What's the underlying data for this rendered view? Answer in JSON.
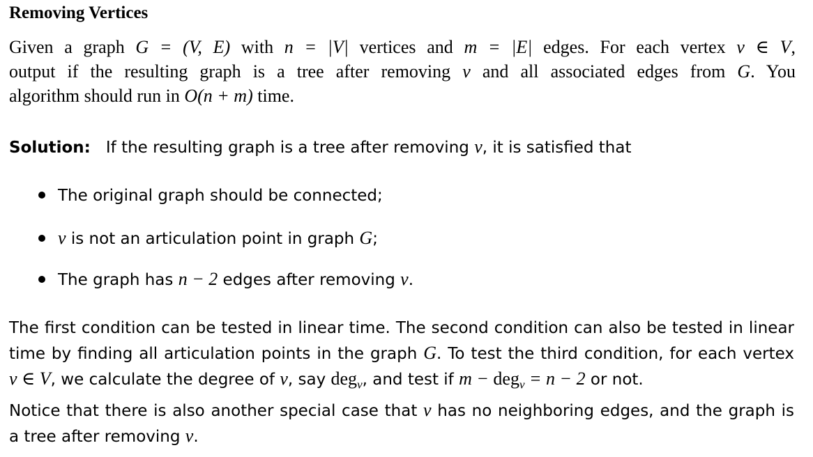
{
  "title": "Removing Vertices",
  "problem": {
    "line1_a": "Given a graph ",
    "line1_b": " with ",
    "line1_c": " vertices and ",
    "line1_d": " edges. For each vertex ",
    "line1_e": ",",
    "line2_a": "output if the resulting graph is a tree after removing ",
    "line2_b": " and all associated edges from ",
    "line2_c": ". You",
    "line3_a": "algorithm should run in ",
    "line3_b": " time.",
    "math": {
      "G_VE": "G = (V, E)",
      "n_V": "n = |V|",
      "m_E": "m = |E|",
      "v_in_V": "v ∈ V",
      "v": "v",
      "G": "G",
      "O_nm": "O(n + m)"
    }
  },
  "solution": {
    "label": "Solution:",
    "intro_a": "If the resulting graph is a tree after removing ",
    "intro_v": "v",
    "intro_b": ", it is satisfied that",
    "bullets": {
      "b1": "The original graph should be connected;",
      "b2_v": "v",
      "b2_text": " is not an articulation point in graph ",
      "b2_G": "G",
      "b2_end": ";",
      "b3_a": "The graph has ",
      "b3_math": "n − 2",
      "b3_b": " edges after removing ",
      "b3_v": "v",
      "b3_end": "."
    },
    "para1": {
      "line1": "The first condition can be tested in linear time. The second condition can also be tested in linear",
      "line2_a": "time by finding all articulation points in the graph ",
      "line2_G": "G",
      "line2_b": ". To test the third condition, for each vertex",
      "line3_vV": "v ∈ V",
      "line3_a": ", we calculate the degree of ",
      "line3_v": "v",
      "line3_b": ", say ",
      "line3_deg": "deg",
      "line3_sub": "v",
      "line3_c": ", and test if ",
      "line3_eq_m": "m − ",
      "line3_eq_deg": "deg",
      "line3_eq_sub": "v",
      "line3_eq_rest": " = n − 2",
      "line3_d": " or not."
    },
    "para2": {
      "line1_a": "Notice that there is also another special case that ",
      "line1_v": "v",
      "line1_b": " has no neighboring edges, and the graph is",
      "line2_a": "a tree after removing ",
      "line2_v": "v",
      "line2_b": "."
    }
  }
}
